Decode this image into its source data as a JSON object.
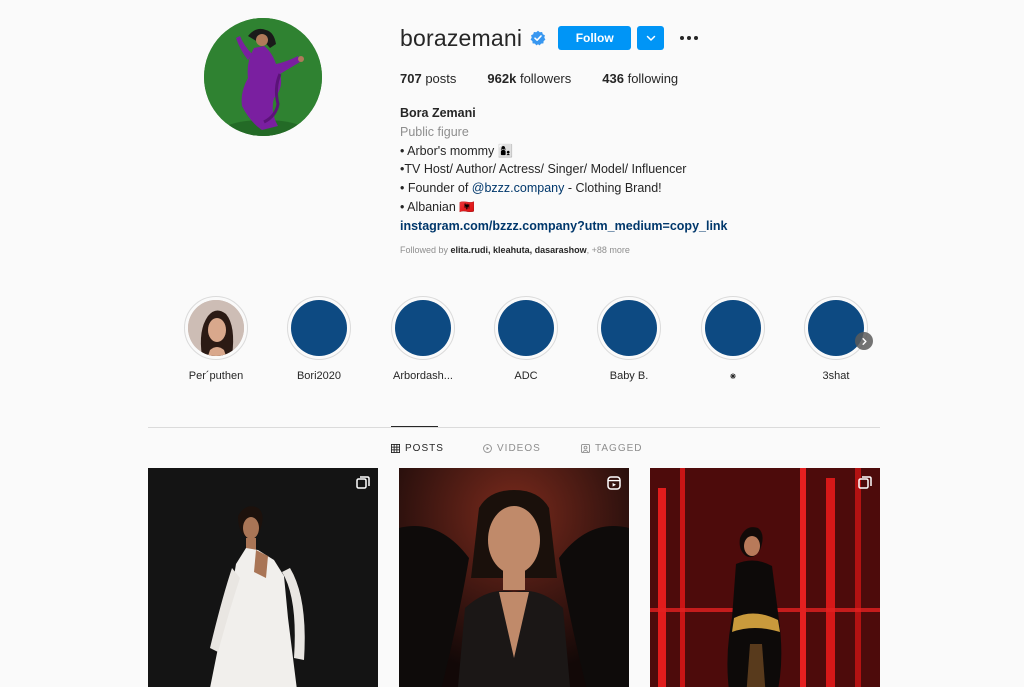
{
  "profile": {
    "username": "borazemani",
    "follow_label": "Follow",
    "stats": {
      "posts_value": "707",
      "posts_label": "posts",
      "followers_value": "962k",
      "followers_label": "followers",
      "following_value": "436",
      "following_label": "following"
    },
    "full_name": "Bora Zemani",
    "category": "Public figure",
    "bio_line1": "• Arbor's mommy 👩‍👦",
    "bio_line2": "•TV Host/ Author/ Actress/ Singer/ Model/ Influencer",
    "bio_line3_prefix": "• Founder of ",
    "bio_line3_mention": "@bzzz.company",
    "bio_line3_suffix": " - Clothing Brand!",
    "bio_line4": "• Albanian 🇦🇱",
    "link": "instagram.com/bzzz.company?utm_medium=copy_link",
    "followed_by_prefix": "Followed by",
    "followed_by_users": "elita.rudi, kleahuta, dasarashow",
    "followed_by_more": "+88 more"
  },
  "highlights": [
    {
      "label": "Per´puthen",
      "has_photo": true
    },
    {
      "label": "Bori2020"
    },
    {
      "label": "Arbordash..."
    },
    {
      "label": "ADC"
    },
    {
      "label": "Baby B."
    },
    {
      "label": "⁕"
    },
    {
      "label": "3shat"
    }
  ],
  "tabs": {
    "posts": "POSTS",
    "videos": "VIDEOS",
    "tagged": "TAGGED"
  },
  "colors": {
    "accent": "#0095f6",
    "highlight_fill": "#0d4a82",
    "link": "#00376b",
    "muted": "#8e8e8e"
  },
  "icons": {
    "verified": "verified-badge-icon",
    "dropdown": "chevron-down-icon",
    "more": "more-options-icon",
    "posts_tab": "grid-icon",
    "videos_tab": "video-icon",
    "tagged_tab": "tagged-icon",
    "carousel": "carousel-icon",
    "reel": "reel-icon"
  }
}
